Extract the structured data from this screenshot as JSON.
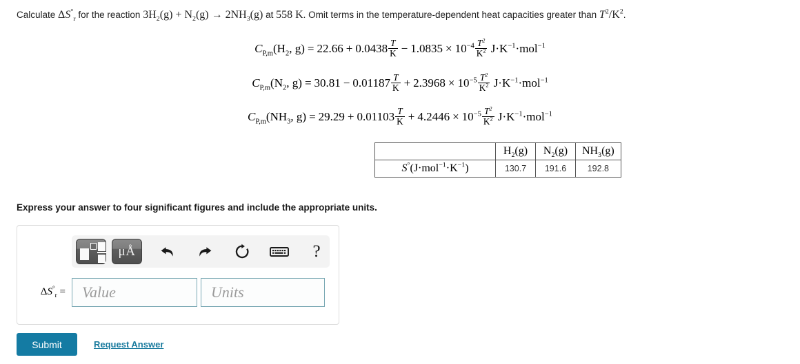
{
  "problem": {
    "prompt_prefix": "Calculate",
    "prompt_symbol_delta": "Δ",
    "prompt_symbol_S": "S",
    "prompt_symbol_sub": "r",
    "prompt_symbol_sup": "°",
    "prompt_mid": "for the reaction",
    "reaction_coeff_h2": "3",
    "reaction_h2": "H",
    "reaction_h2_sub": "2",
    "reaction_h2_state": "(g)",
    "reaction_plus": "+",
    "reaction_n2": "N",
    "reaction_n2_sub": "2",
    "reaction_n2_state": "(g)",
    "reaction_arrow": "→",
    "reaction_coeff_nh3": "2",
    "reaction_nh3": "NH",
    "reaction_nh3_sub": "3",
    "reaction_nh3_state": "(g)",
    "prompt_at": "at",
    "temperature": "558",
    "temperature_unit": "K",
    "prompt_suffix": ". Omit terms in the temperature-dependent heat capacities greater than",
    "omit_term_base": "T",
    "omit_term_exp": "2",
    "omit_term_slash": "/",
    "omit_term_unit": "K",
    "omit_term_unit_exp": "2",
    "prompt_period": "."
  },
  "equations": [
    {
      "id": "h2",
      "symbol": "C",
      "symbol_sub": "P,m",
      "species": "H",
      "species_sub": "2",
      "species_state": ", g",
      "equals": "=",
      "a": "22.66",
      "sign_b": "+",
      "b": "0.0438",
      "frac_b_num": "T",
      "frac_b_den": "K",
      "sign_c": "−",
      "c": "1.0835",
      "times": "×",
      "ten": "10",
      "exponent": "−4",
      "frac_c_num": "T",
      "frac_c_num_exp": "2",
      "frac_c_den": "K",
      "frac_c_den_exp": "2",
      "units_j": "J",
      "units_dot": "·",
      "units_k": "K",
      "units_k_exp": "−1",
      "units_mol": "mol",
      "units_mol_exp": "−1"
    },
    {
      "id": "n2",
      "symbol": "C",
      "symbol_sub": "P,m",
      "species": "N",
      "species_sub": "2",
      "species_state": ", g",
      "equals": "=",
      "a": "30.81",
      "sign_b": "−",
      "b": "0.01187",
      "frac_b_num": "T",
      "frac_b_den": "K",
      "sign_c": "+",
      "c": "2.3968",
      "times": "×",
      "ten": "10",
      "exponent": "−5",
      "frac_c_num": "T",
      "frac_c_num_exp": "2",
      "frac_c_den": "K",
      "frac_c_den_exp": "2",
      "units_j": "J",
      "units_dot": "·",
      "units_k": "K",
      "units_k_exp": "−1",
      "units_mol": "mol",
      "units_mol_exp": "−1"
    },
    {
      "id": "nh3",
      "symbol": "C",
      "symbol_sub": "P,m",
      "species": "NH",
      "species_sub": "3",
      "species_state": ", g",
      "equals": "=",
      "a": "29.29",
      "sign_b": "+",
      "b": "0.01103",
      "frac_b_num": "T",
      "frac_b_den": "K",
      "sign_c": "+",
      "c": "4.2446",
      "times": "×",
      "ten": "10",
      "exponent": "−5",
      "frac_c_num": "T",
      "frac_c_num_exp": "2",
      "frac_c_den": "K",
      "frac_c_den_exp": "2",
      "units_j": "J",
      "units_dot": "·",
      "units_k": "K",
      "units_k_exp": "−1",
      "units_mol": "mol",
      "units_mol_exp": "−1"
    }
  ],
  "entropy_table": {
    "corner": "",
    "row_label_S": "S",
    "row_label_deg": "°",
    "row_label_open": "(J",
    "row_label_dot1": "·",
    "row_label_mol": "mol",
    "row_label_mol_exp": "−1",
    "row_label_dot2": "·",
    "row_label_k": "K",
    "row_label_k_exp": "−1",
    "row_label_close": ")",
    "columns": [
      {
        "species": "H",
        "sub": "2",
        "state": "(g)"
      },
      {
        "species": "N",
        "sub": "2",
        "state": "(g)"
      },
      {
        "species": "NH",
        "sub": "3",
        "state": "(g)"
      }
    ],
    "values": [
      "130.7",
      "191.6",
      "192.8"
    ]
  },
  "instruction": "Express your answer to four significant figures and include the appropriate units.",
  "answer": {
    "label_delta": "Δ",
    "label_S": "S",
    "label_sub": "r",
    "label_sup": "°",
    "label_equals": "=",
    "value_placeholder": "Value",
    "units_placeholder": "Units",
    "value_text": "",
    "units_text": ""
  },
  "mathbar": {
    "template_icon": "math-template-icon",
    "units_icon_label": "μÅ",
    "undo_icon": "undo-arrow-icon",
    "redo_icon": "redo-arrow-icon",
    "reset_icon": "reset-circular-arrow-icon",
    "keyboard_icon": "keyboard-icon",
    "help_label": "?"
  },
  "footer": {
    "submit_label": "Submit",
    "request_answer_label": "Request Answer"
  },
  "colors": {
    "submit_background": "#147ba3",
    "link": "#1a7b9e",
    "field_border": "#79a8b3",
    "panel_border": "#dcdcdc",
    "mathbar_background": "#f3f3f3"
  }
}
